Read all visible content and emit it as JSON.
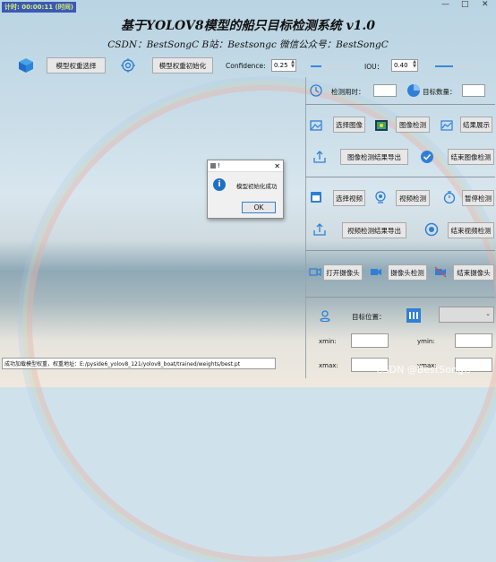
{
  "app": {
    "timer": "计时: 00:00:11 (时间)",
    "title": "基于YOLOV8模型的船只目标检测系统 v1.0",
    "subtitle": "CSDN：BestSongC   B站：Bestsongc   微信公众号：BestSongC",
    "window_controls": [
      "—",
      "□",
      "✕"
    ]
  },
  "toolbar": {
    "select_weights": "模型权重选择",
    "init_weights": "模型权重初始化",
    "confidence_label": "Confidence:",
    "confidence_value": "0.25",
    "confidence_level": 0.25,
    "iou_label": "IOU：",
    "iou_value": "0.40",
    "iou_level": 0.4
  },
  "stats": {
    "time_label": "检测用时：",
    "time_value": "",
    "count_label": "目标数量：",
    "count_value": ""
  },
  "image": {
    "select": "选择图像",
    "detect": "图像检测",
    "show_result": "结果展示",
    "export": "图像检测结果导出",
    "end": "结束图像检测"
  },
  "video": {
    "select": "选择视频",
    "detect": "视频检测",
    "pause": "暂停检测",
    "export": "视频检测结果导出",
    "end": "结束视频检测"
  },
  "camera": {
    "open": "打开摄像头",
    "detect": "摄像头检测",
    "end": "结束摄像头"
  },
  "target": {
    "position_label": "目标位置：",
    "select_value": "",
    "xmin": "xmin:",
    "ymin": "ymin:",
    "xmax": "xmax:",
    "ymax": "ymax:"
  },
  "status_bar": "成功加载模型权重，权重地址：E:/pyside6_yolov8_121/yolov8_boat/trained/weights/best.pt",
  "dialog": {
    "title": "!",
    "message": "模型初始化成功",
    "ok": "OK"
  },
  "watermark": "CSDN @BestSongC",
  "colors": {
    "accent": "#2f7fd6",
    "timer_bg": "#3b59b5"
  }
}
